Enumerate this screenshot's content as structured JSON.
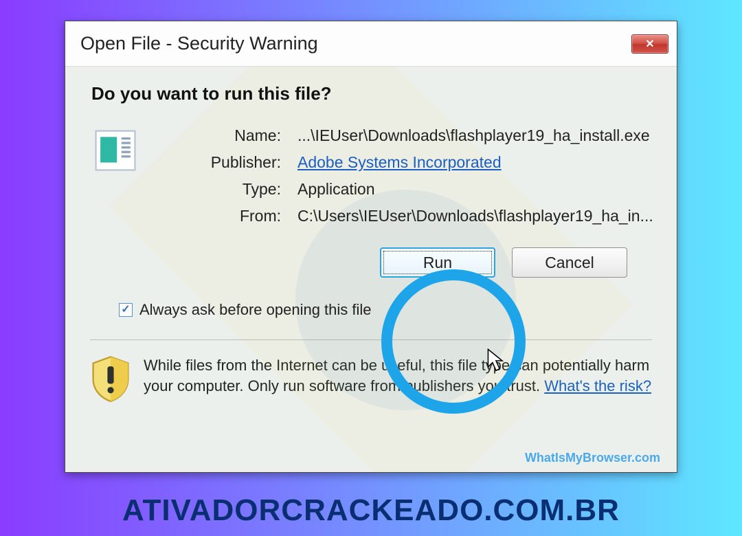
{
  "dialog": {
    "title": "Open File - Security Warning",
    "question": "Do you want to run this file?",
    "labels": {
      "name": "Name:",
      "publisher": "Publisher:",
      "type": "Type:",
      "from": "From:"
    },
    "values": {
      "name": "...\\IEUser\\Downloads\\flashplayer19_ha_install.exe",
      "publisher": "Adobe Systems Incorporated",
      "type": "Application",
      "from": "C:\\Users\\IEUser\\Downloads\\flashplayer19_ha_in..."
    },
    "buttons": {
      "run": "Run",
      "cancel": "Cancel"
    },
    "checkbox_label": "Always ask before opening this file",
    "checkbox_checked": true,
    "warning_text": "While files from the Internet can be useful, this file type can potentially harm your computer. Only run software from publishers you trust. ",
    "risk_link": "What's the risk?"
  },
  "watermark_site": "WhatIsMyBrowser.com",
  "brand_footer": "ATIVADORCRACKEADO.COM.BR"
}
